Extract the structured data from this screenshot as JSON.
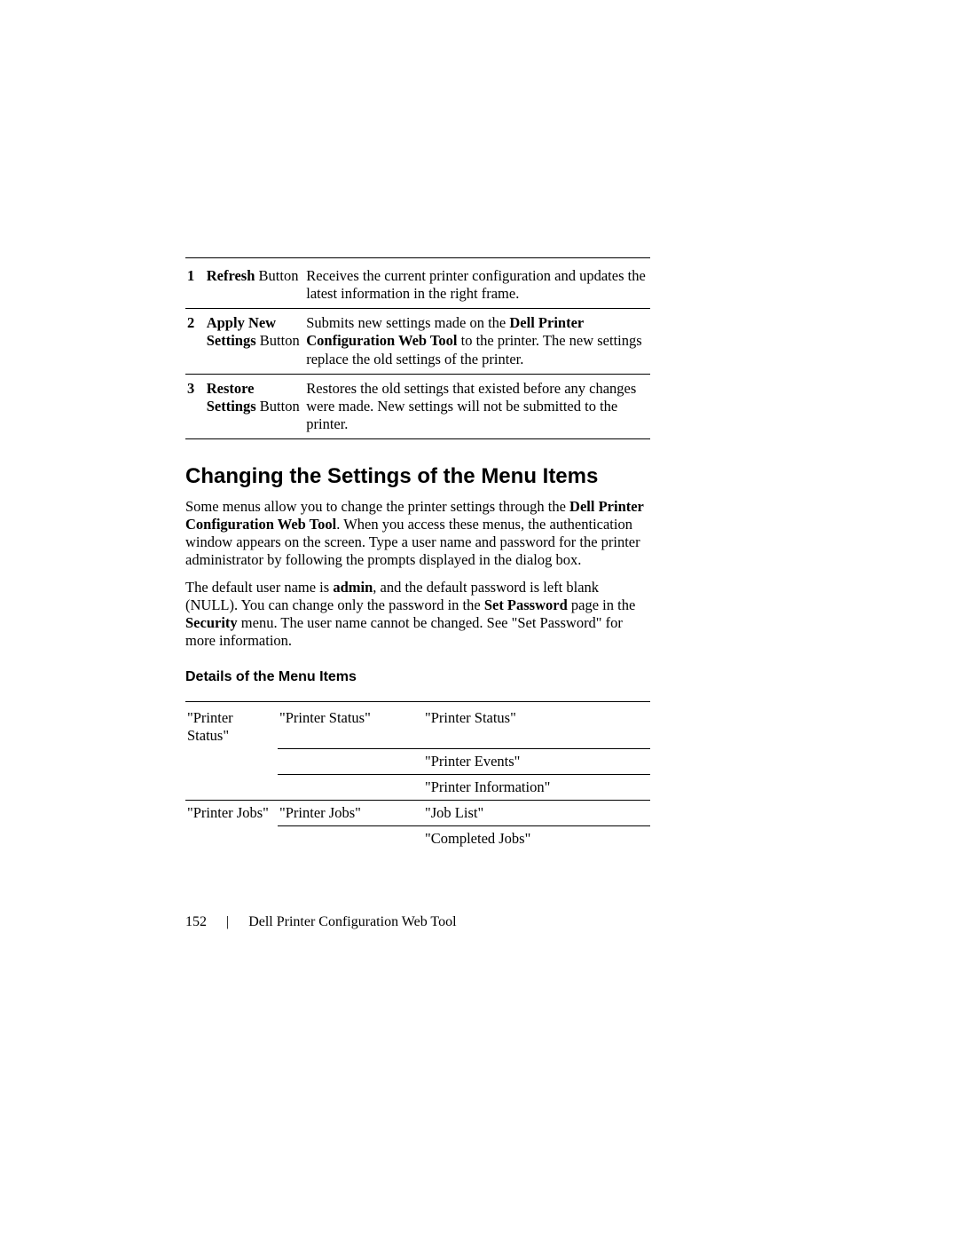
{
  "buttons_table": {
    "rows": [
      {
        "num": "1",
        "name_bold": "Refresh",
        "name_rest": " Button",
        "desc_pre": "Receives the current printer configuration and updates the latest information in the right frame.",
        "desc_bold1": "",
        "desc_mid": "",
        "desc_bold2": "",
        "desc_post": ""
      },
      {
        "num": "2",
        "name_bold": "Apply New Settings",
        "name_rest": " Button",
        "desc_pre": "Submits new settings made on the ",
        "desc_bold1": "Dell Printer Configuration Web Tool",
        "desc_mid": " to the printer. The new settings replace the old settings of the printer.",
        "desc_bold2": "",
        "desc_post": ""
      },
      {
        "num": "3",
        "name_bold": "Restore Settings",
        "name_rest": " Button",
        "desc_pre": "Restores the old settings that existed before any changes were made. New settings will not be submitted to the printer.",
        "desc_bold1": "",
        "desc_mid": "",
        "desc_bold2": "",
        "desc_post": ""
      }
    ]
  },
  "heading": "Changing the Settings of the Menu Items",
  "para1": {
    "pre": "Some menus allow you to change the printer settings through the ",
    "bold1": "Dell Printer Configuration Web Tool",
    "post": ". When you access these menus, the authentication window appears on the screen. Type a user name and password for the printer administrator by following the prompts displayed in the dialog box."
  },
  "para2": {
    "pre": "The default user name is ",
    "bold1": "admin",
    "mid1": ", and the default password is left blank (NULL). You can change only the password in the ",
    "bold2": "Set Password",
    "mid2": " page in the ",
    "bold3": "Security",
    "post": " menu. The user name cannot be changed. See \"Set Password\" for more information."
  },
  "subheading": "Details of the Menu Items",
  "menu_table": {
    "row1": {
      "c1": "\"Printer Status\"",
      "c2": "\"Printer Status\"",
      "c3": "\"Printer Status\""
    },
    "row2": {
      "c1": "",
      "c2": "",
      "c3": "\"Printer Events\""
    },
    "row3": {
      "c1": "",
      "c2": "",
      "c3": "\"Printer Information\""
    },
    "row4": {
      "c1": "\"Printer Jobs\"",
      "c2": "\"Printer Jobs\"",
      "c3": "\"Job List\""
    },
    "row5": {
      "c1": "",
      "c2": "",
      "c3": "\"Completed Jobs\""
    }
  },
  "footer": {
    "page_number": "152",
    "separator": "|",
    "title": "Dell Printer Configuration Web Tool"
  }
}
